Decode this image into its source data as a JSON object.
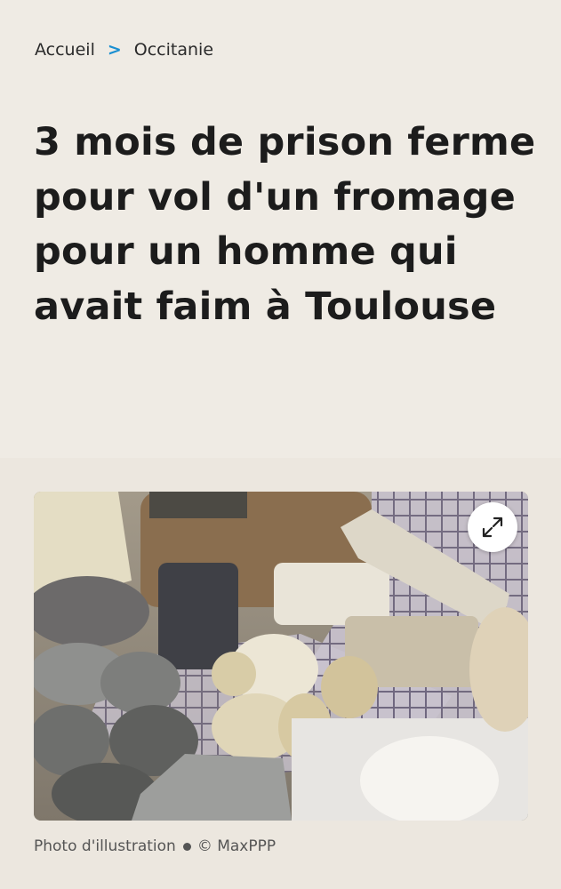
{
  "breadcrumb": {
    "home": "Accueil",
    "separator": ">",
    "section": "Occitanie"
  },
  "article": {
    "title": "3 mois de prison ferme pour vol d'un fromage pour un homme qui avait faim à Toulouse"
  },
  "image": {
    "subject": "cheeses",
    "expand_icon": "expand-arrows-icon",
    "caption_text": "Photo d'illustration",
    "caption_credit": "© MaxPPP"
  },
  "colors": {
    "background": "#efebe4",
    "accent": "#1a8fd1",
    "title": "#1c1c1c"
  }
}
